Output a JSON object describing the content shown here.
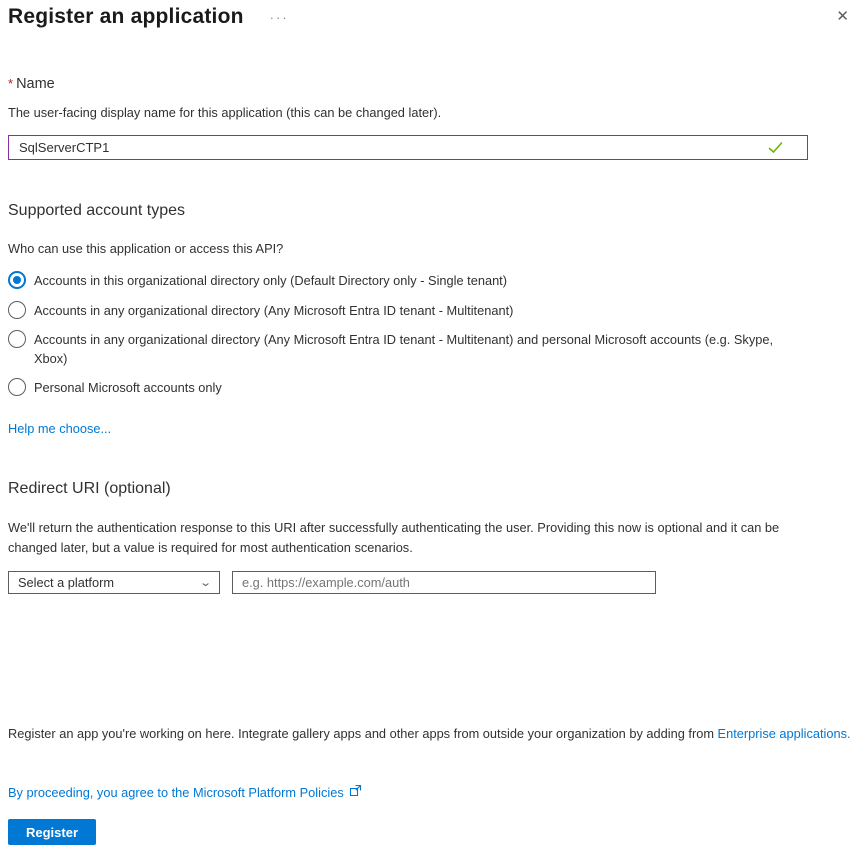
{
  "header": {
    "title": "Register an application",
    "more_menu": "···",
    "close": "✕"
  },
  "name_section": {
    "required_mark": "*",
    "label": "Name",
    "description": "The user-facing display name for this application (this can be changed later).",
    "value": "SqlServerCTP1"
  },
  "account_types": {
    "heading": "Supported account types",
    "question": "Who can use this application or access this API?",
    "options": [
      {
        "label": "Accounts in this organizational directory only (Default Directory only - Single tenant)",
        "selected": true
      },
      {
        "label": "Accounts in any organizational directory (Any Microsoft Entra ID tenant - Multitenant)",
        "selected": false
      },
      {
        "label": "Accounts in any organizational directory (Any Microsoft Entra ID tenant - Multitenant) and personal Microsoft accounts (e.g. Skype, Xbox)",
        "selected": false
      },
      {
        "label": "Personal Microsoft accounts only",
        "selected": false
      }
    ],
    "help_link": "Help me choose..."
  },
  "redirect_section": {
    "heading": "Redirect URI (optional)",
    "description": "We'll return the authentication response to this URI after successfully authenticating the user. Providing this now is optional and it can be changed later, but a value is required for most authentication scenarios.",
    "platform_selected": "Select a platform",
    "uri_placeholder": "e.g. https://example.com/auth"
  },
  "footer": {
    "note_before_link": "Register an app you're working on here. Integrate gallery apps and other apps from outside your organization by adding from ",
    "note_link": "Enterprise applications",
    "note_after_link": ".",
    "policy_link": "By proceeding, you agree to the Microsoft Platform Policies",
    "register_button": "Register"
  },
  "colors": {
    "accent_blue": "#0078d4",
    "focus_border_purple": "#8a2da5",
    "success_green": "#6bb700",
    "required_red": "#a4262c",
    "text": "#323130"
  }
}
